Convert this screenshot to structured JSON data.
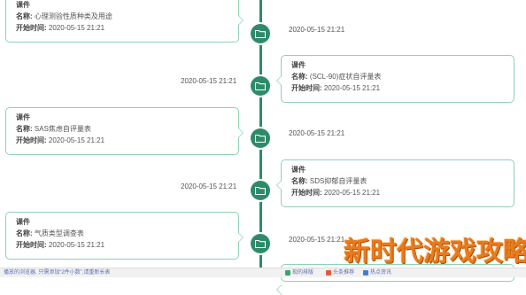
{
  "timeline": [
    {
      "side": "left",
      "type": "课件",
      "name_label": "名称:",
      "name": "心理测验性质种类及用途",
      "start_label": "开始时间:",
      "start": "2020-05-15 21:21",
      "date": "2020-05-15 21:21"
    },
    {
      "side": "right",
      "type": "课件",
      "name_label": "名称:",
      "name": "(SCL-90)症状自评量表",
      "start_label": "开始时间:",
      "start": "2020-05-15 21:21",
      "date": "2020-05-15 21:21"
    },
    {
      "side": "left",
      "type": "课件",
      "name_label": "名称:",
      "name": "SAS焦虑自评量表",
      "start_label": "开始时间:",
      "start": "2020-05-15 21:21",
      "date": "2020-05-15 21:21"
    },
    {
      "side": "right",
      "type": "课件",
      "name_label": "名称:",
      "name": "SDS抑郁自评量表",
      "start_label": "开始时间:",
      "start": "2020-05-15 21:21",
      "date": "2020-05-15 21:21"
    },
    {
      "side": "left",
      "type": "课件",
      "name_label": "名称:",
      "name": "气质类型调查表",
      "start_label": "开始时间:",
      "start": "2020-05-15 21:21",
      "date": "2020-05-15 21:21"
    }
  ],
  "statusbar": {
    "left_text": "播放的浏览器, 只需添加“2件小数”,请重新长表",
    "item1": "现的排版",
    "item2": "头条推荐",
    "item3": "热点资讯"
  },
  "watermark": "新时代游戏攻略",
  "colors": {
    "accent": "#2e8b6a",
    "card_border": "#8fd1b3",
    "watermark": "#e87b1e"
  }
}
